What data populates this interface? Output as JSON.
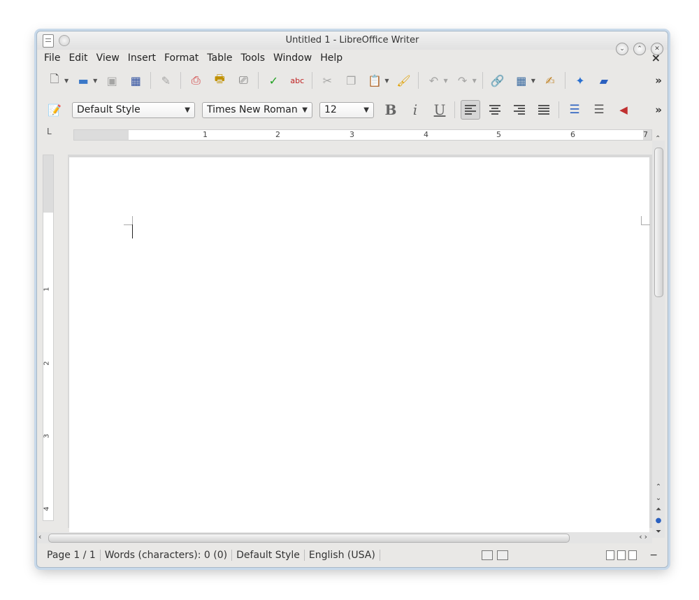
{
  "window": {
    "title": "Untitled 1 - LibreOffice Writer"
  },
  "menubar": {
    "items": [
      "File",
      "Edit",
      "View",
      "Insert",
      "Format",
      "Table",
      "Tools",
      "Window",
      "Help"
    ]
  },
  "toolbar_standard": {
    "buttons": [
      {
        "name": "new-document",
        "icon": "new-doc-icon"
      },
      {
        "name": "open",
        "icon": "folder-icon"
      },
      {
        "name": "save",
        "icon": "save-icon"
      },
      {
        "name": "save-as",
        "icon": "save-as-icon"
      },
      {
        "name": "edit-mode",
        "icon": "pencil-icon"
      },
      {
        "name": "export-pdf",
        "icon": "pdf-icon"
      },
      {
        "name": "print-direct",
        "icon": "print-icon"
      },
      {
        "name": "print-preview",
        "icon": "print-preview-icon"
      },
      {
        "name": "spellcheck",
        "icon": "spellcheck-icon"
      },
      {
        "name": "auto-spellcheck",
        "icon": "auto-spellcheck-icon"
      },
      {
        "name": "cut",
        "icon": "scissors-icon"
      },
      {
        "name": "copy",
        "icon": "copy-icon"
      },
      {
        "name": "paste",
        "icon": "paste-icon"
      },
      {
        "name": "clone-formatting",
        "icon": "paintbrush-icon"
      },
      {
        "name": "undo",
        "icon": "undo-icon"
      },
      {
        "name": "redo",
        "icon": "redo-icon"
      },
      {
        "name": "hyperlink",
        "icon": "hyperlink-icon"
      },
      {
        "name": "table",
        "icon": "table-icon"
      },
      {
        "name": "draw-functions",
        "icon": "draw-icon"
      },
      {
        "name": "navigator",
        "icon": "navigator-icon"
      },
      {
        "name": "gallery",
        "icon": "gallery-icon"
      }
    ],
    "overflow": "»"
  },
  "toolbar_formatting": {
    "paragraph_style": "Default Style",
    "font_name": "Times New Roman",
    "font_size": "12",
    "bold": "B",
    "italic": "i",
    "underline": "U",
    "overflow": "»"
  },
  "ruler": {
    "h_numbers": [
      "1",
      "2",
      "3",
      "4",
      "5",
      "6",
      "7"
    ],
    "v_numbers": [
      "1",
      "2",
      "3",
      "4"
    ],
    "tab_corner": "L"
  },
  "statusbar": {
    "page": "Page 1 / 1",
    "words": "Words (characters): 0 (0)",
    "style": "Default Style",
    "language": "English (USA)",
    "zoom_minus": "−"
  }
}
